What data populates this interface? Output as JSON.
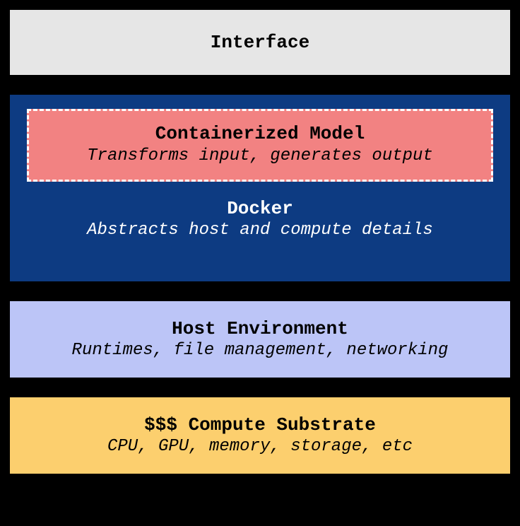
{
  "layers": {
    "interface": {
      "title": "Interface"
    },
    "containerized": {
      "title": "Containerized Model",
      "subtitle": "Transforms input, generates output"
    },
    "docker": {
      "title": "Docker",
      "subtitle": "Abstracts host and compute details"
    },
    "host": {
      "title": "Host Environment",
      "subtitle": "Runtimes, file management, networking"
    },
    "compute": {
      "title": "$$$ Compute Substrate",
      "subtitle": "CPU, GPU, memory, storage, etc"
    }
  },
  "colors": {
    "interface_bg": "#e6e6e6",
    "docker_bg": "#0d3b82",
    "containerized_bg": "#f28282",
    "host_bg": "#bcc5f7",
    "compute_bg": "#fccf6e"
  }
}
